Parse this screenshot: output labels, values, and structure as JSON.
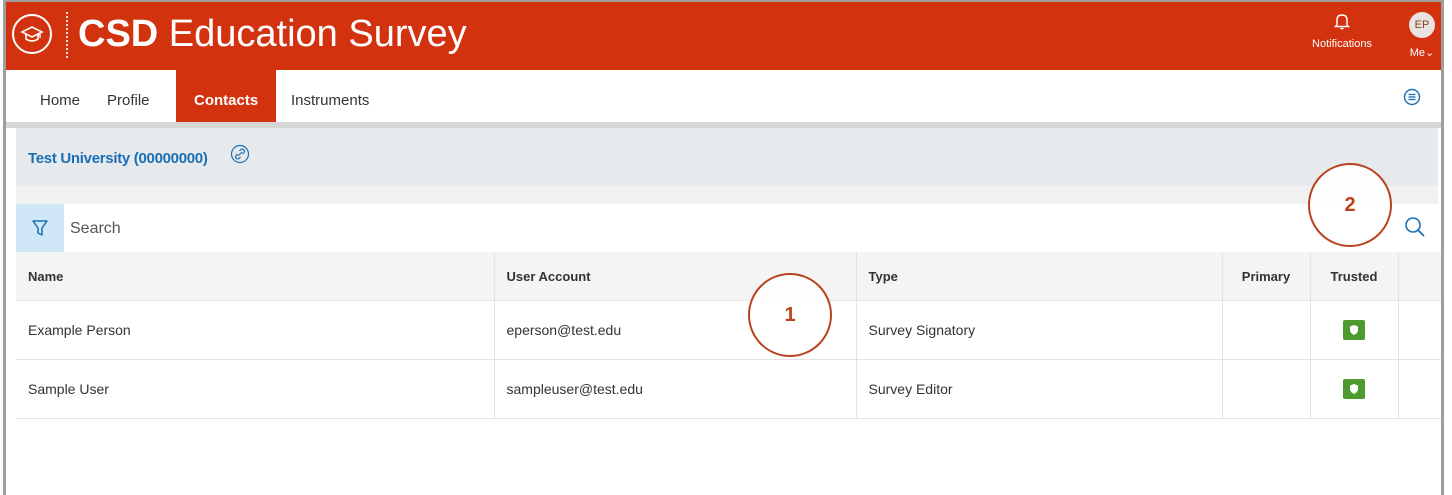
{
  "header": {
    "title_bold": "CSD",
    "title_rest": "Education Survey",
    "notifications_label": "Notifications",
    "avatar_initials": "EP",
    "me_label": "Me",
    "me_chevron": "⌄"
  },
  "nav": {
    "items": [
      {
        "label": "Home"
      },
      {
        "label": "Profile"
      },
      {
        "label": "Contacts"
      },
      {
        "label": "Instruments"
      }
    ],
    "active": "Contacts"
  },
  "org": {
    "title": "Test University (00000000)"
  },
  "search": {
    "placeholder": "Search"
  },
  "table": {
    "columns": [
      "Name",
      "User Account",
      "Type",
      "Primary",
      "Trusted",
      ""
    ],
    "rows": [
      {
        "name": "Example Person",
        "account": "eperson@test.edu",
        "type": "Survey Signatory",
        "primary": "",
        "trusted": true
      },
      {
        "name": "Sample User",
        "account": "sampleuser@test.edu",
        "type": "Survey Editor",
        "primary": "",
        "trusted": true
      }
    ]
  },
  "callouts": {
    "one": "1",
    "two": "2"
  },
  "colors": {
    "brand": "#d3320f",
    "link": "#1a6fb5",
    "trusted": "#4e9a2e",
    "callout": "#b8431c"
  },
  "icons": [
    "graduation-cap-icon",
    "bell-icon",
    "menu-circle-icon",
    "link-icon",
    "filter-icon",
    "search-icon",
    "shield-icon"
  ]
}
